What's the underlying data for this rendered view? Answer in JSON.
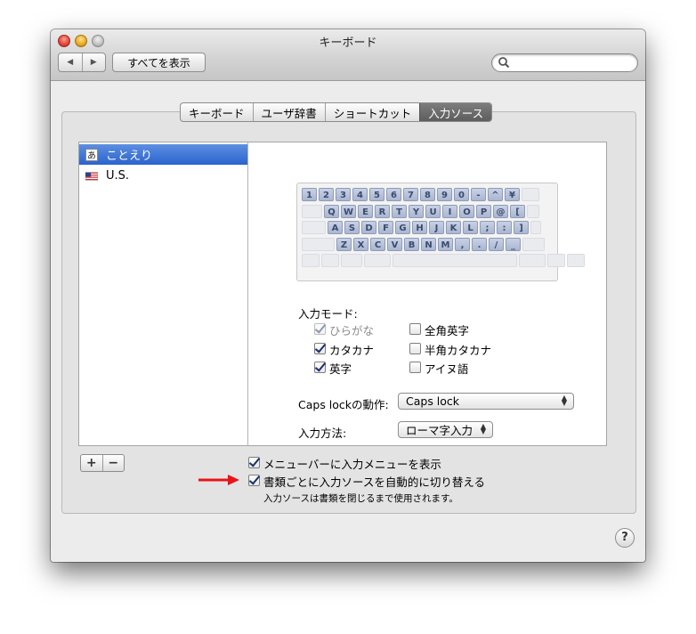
{
  "window": {
    "title": "キーボード"
  },
  "toolbar": {
    "back": "◀",
    "forward": "▶",
    "show_all": "すべてを表示",
    "search_placeholder": "",
    "search_value": ""
  },
  "tabs": [
    "キーボード",
    "ユーザ辞書",
    "ショートカット",
    "入力ソース"
  ],
  "selected_tab": "入力ソース",
  "sources": [
    {
      "label": "ことえり",
      "icon": "hiragana-a-icon",
      "icon_text": "あ",
      "selected": true
    },
    {
      "label": "U.S.",
      "icon": "us-flag-icon",
      "selected": false
    }
  ],
  "keyboard_rows": [
    [
      "1",
      "2",
      "3",
      "4",
      "5",
      "6",
      "7",
      "8",
      "9",
      "0",
      "-",
      "^",
      "¥",
      ""
    ],
    [
      "",
      "Q",
      "W",
      "E",
      "R",
      "T",
      "Y",
      "U",
      "I",
      "O",
      "P",
      "@",
      "[",
      ""
    ],
    [
      "",
      "A",
      "S",
      "D",
      "F",
      "G",
      "H",
      "J",
      "K",
      "L",
      ";",
      ":",
      "]",
      ""
    ],
    [
      "",
      "Z",
      "X",
      "C",
      "V",
      "B",
      "N",
      "M",
      ",",
      ".",
      "/",
      "_",
      ""
    ]
  ],
  "input_mode": {
    "label": "入力モード:",
    "options": [
      {
        "label": "ひらがな",
        "checked": true,
        "disabled": true
      },
      {
        "label": "全角英字",
        "checked": false,
        "disabled": false
      },
      {
        "label": "カタカナ",
        "checked": true,
        "disabled": false
      },
      {
        "label": "半角カタカナ",
        "checked": false,
        "disabled": false
      },
      {
        "label": "英字",
        "checked": true,
        "disabled": false
      },
      {
        "label": "アイヌ語",
        "checked": false,
        "disabled": false
      }
    ]
  },
  "caps_lock": {
    "label": "Caps lockの動作:",
    "value": "Caps lock"
  },
  "input_method": {
    "label": "入力方法:",
    "value": "ローマ字入力"
  },
  "list_buttons": {
    "add": "+",
    "remove": "−"
  },
  "options": [
    {
      "label": "メニューバーに入力メニューを表示",
      "checked": true
    },
    {
      "label": "書類ごとに入力ソースを自動的に切り替える",
      "checked": true
    }
  ],
  "note": "入力ソースは書類を閉じるまで使用されます。",
  "help": "?",
  "colors": {
    "selection": "#2b63cf",
    "arrow": "#e8141a",
    "key": "#aab6d1"
  }
}
